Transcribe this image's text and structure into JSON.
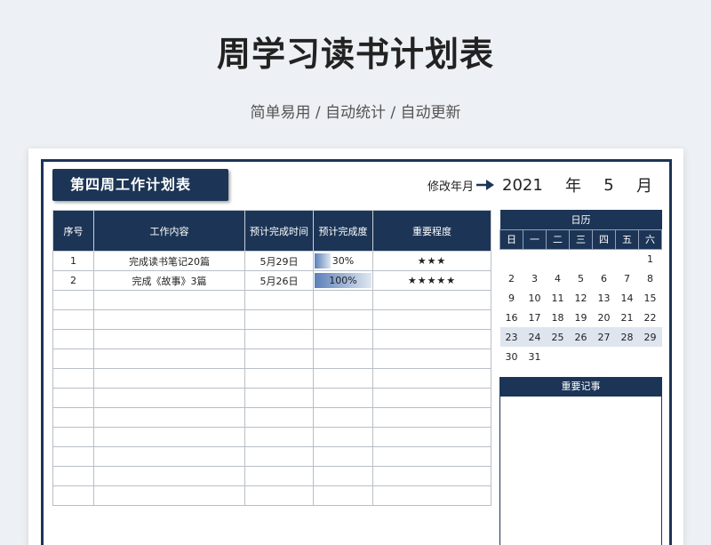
{
  "page": {
    "title": "周学习读书计划表",
    "subtitle": "简单易用 / 自动统计 / 自动更新"
  },
  "sheet": {
    "week_title": "第四周工作计划表",
    "modify_label": "修改年月",
    "year": "2021",
    "year_unit": "年",
    "month": "5",
    "month_unit": "月"
  },
  "plan_table": {
    "headers": [
      "序号",
      "工作内容",
      "预计完成时间",
      "预计完成度",
      "重要程度"
    ],
    "rows": [
      {
        "no": "1",
        "content": "完成读书笔记20篇",
        "date": "5月29日",
        "progress": 0.3,
        "progress_label": "30%",
        "stars": "★★★"
      },
      {
        "no": "2",
        "content": "完成《故事》3篇",
        "date": "5月26日",
        "progress": 1.0,
        "progress_label": "100%",
        "stars": "★★★★★"
      }
    ],
    "empty_rows": 11
  },
  "calendar": {
    "title": "日历",
    "weekdays": [
      "日",
      "一",
      "二",
      "三",
      "四",
      "五",
      "六"
    ],
    "weeks": [
      [
        "",
        "",
        "",
        "",
        "",
        "",
        "1"
      ],
      [
        "2",
        "3",
        "4",
        "5",
        "6",
        "7",
        "8"
      ],
      [
        "9",
        "10",
        "11",
        "12",
        "13",
        "14",
        "15"
      ],
      [
        "16",
        "17",
        "18",
        "19",
        "20",
        "21",
        "22"
      ],
      [
        "23",
        "24",
        "25",
        "26",
        "27",
        "28",
        "29"
      ],
      [
        "30",
        "31",
        "",
        "",
        "",
        "",
        ""
      ]
    ],
    "highlight_week": 4,
    "notes_label": "重要记事"
  },
  "colors": {
    "navy": "#1c3556",
    "highlight": "#dfe5ee"
  }
}
